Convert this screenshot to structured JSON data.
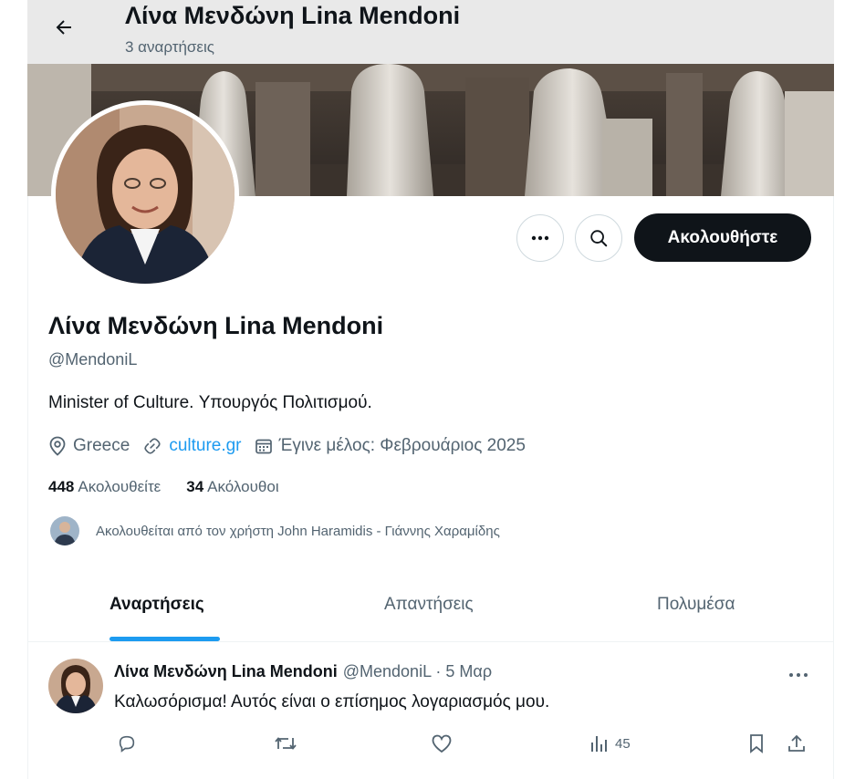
{
  "header": {
    "title": "Λίνα Μενδώνη Lina Mendoni",
    "subtitle": "3 αναρτήσεις",
    "back_icon": "arrow-left-icon"
  },
  "profile": {
    "display_name": "Λίνα Μενδώνη Lina Mendoni",
    "handle": "@MendoniL",
    "bio": "Minister of Culture. Υπουργός Πολιτισμού.",
    "location": "Greece",
    "website": "culture.gr",
    "joined": "Έγινε μέλος: Φεβρουάριος 2025",
    "following_count": "448",
    "following_label": "Ακολουθείτε",
    "followers_count": "34",
    "followers_label": "Ακόλουθοι",
    "followed_by_text": "Ακολουθείται από τον χρήστη John Haramidis - Γιάννης Χαραμίδης"
  },
  "actions": {
    "follow_label": "Ακολουθήστε",
    "more_icon": "more-horizontal-icon",
    "search_icon": "search-icon"
  },
  "tabs": [
    {
      "label": "Αναρτήσεις",
      "active": true
    },
    {
      "label": "Απαντήσεις",
      "active": false
    },
    {
      "label": "Πολυμέσα",
      "active": false
    }
  ],
  "post": {
    "author_name": "Λίνα Μενδώνη Lina Mendoni",
    "author_handle_time": "@MendoniL · 5 Μαρ",
    "text": "Καλωσόρισμα! Αυτός είναι ο επίσημος λογαριασμός μου.",
    "views": "45"
  },
  "colors": {
    "accent": "#1d9bf0",
    "text_primary": "#0f1419",
    "text_secondary": "#536471",
    "follow_button_bg": "#0f1419",
    "header_bg": "#e9e9e9"
  }
}
